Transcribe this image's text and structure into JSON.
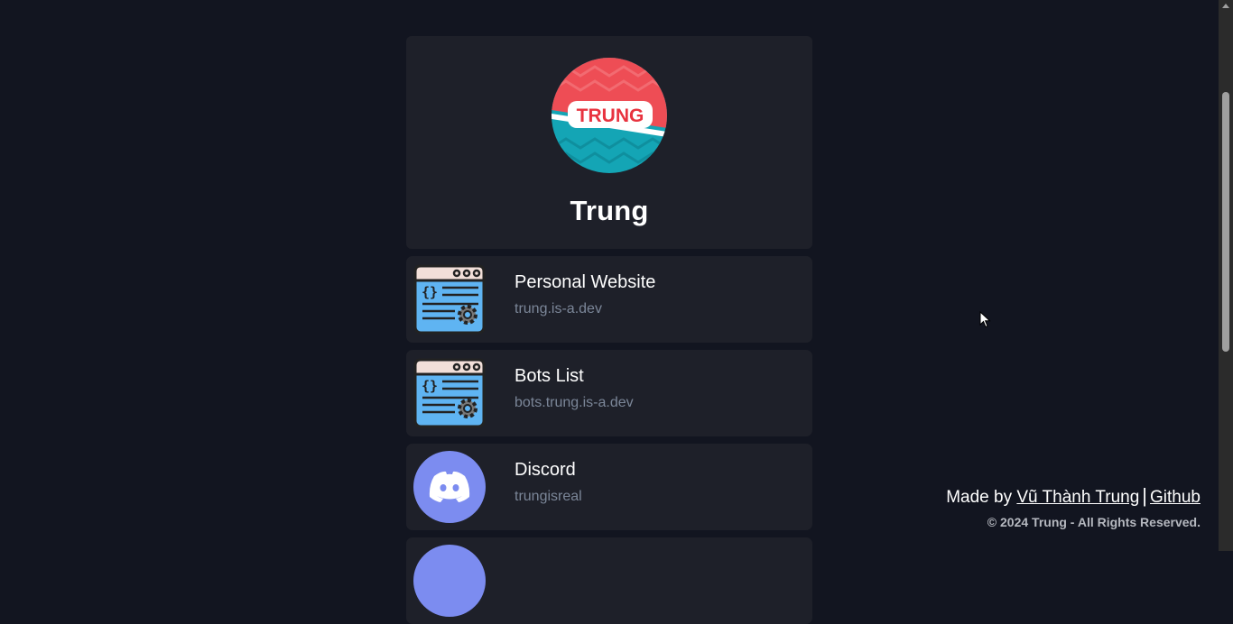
{
  "profile": {
    "name": "Trung",
    "avatar_text": "TRUNG"
  },
  "links": [
    {
      "title": "Personal Website",
      "subtitle": "trung.is-a.dev",
      "icon": "code-window-icon"
    },
    {
      "title": "Bots List",
      "subtitle": "bots.trung.is-a.dev",
      "icon": "code-window-icon"
    },
    {
      "title": "Discord",
      "subtitle": "trungisreal",
      "icon": "discord-icon"
    }
  ],
  "footer": {
    "made_by": "Made by",
    "author": "Vũ Thành Trung",
    "separator": "|",
    "github": "Github",
    "copyright": "© 2024 Trung - All Rights Reserved."
  },
  "colors": {
    "background": "#121520",
    "card": "#1e2029",
    "subtitle": "#7b8698",
    "discord": "#7c8cf0"
  }
}
